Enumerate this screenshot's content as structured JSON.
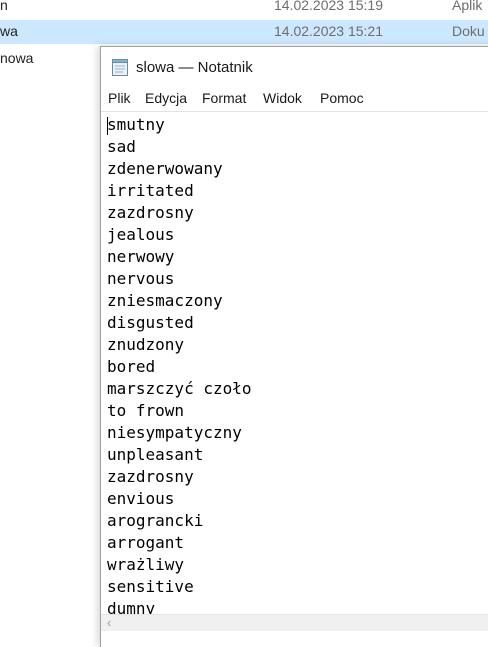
{
  "explorer": {
    "rows": [
      {
        "name": "n",
        "date": "14.02.2023 15:19",
        "type": "Aplik"
      },
      {
        "name": "wa",
        "date": "14.02.2023 15:21",
        "type": "Doku"
      },
      {
        "name": "nowa",
        "date": "",
        "type": ""
      }
    ],
    "selected_row": 1,
    "selection_color": "#cce8ff"
  },
  "notepad": {
    "title": "slowa — Notatnik",
    "icon": "notepad-icon",
    "menu": [
      "Plik",
      "Edycja",
      "Format",
      "Widok",
      "Pomoc"
    ],
    "lines": [
      "smutny",
      "sad",
      "zdenerwowany",
      "irritated",
      "zazdrosny",
      "jealous",
      "nerwowy",
      "nervous",
      "zniesmaczony",
      "disgusted",
      "znudzony",
      "bored",
      "marszczyć czoło",
      "to frown",
      "niesympatyczny",
      "unpleasant",
      "zazdrosny",
      "envious",
      "arograncki",
      "arrogant",
      "wrażliwy",
      "sensitive",
      "dumny"
    ],
    "scrollbar_icon": "chevron-left-icon"
  }
}
